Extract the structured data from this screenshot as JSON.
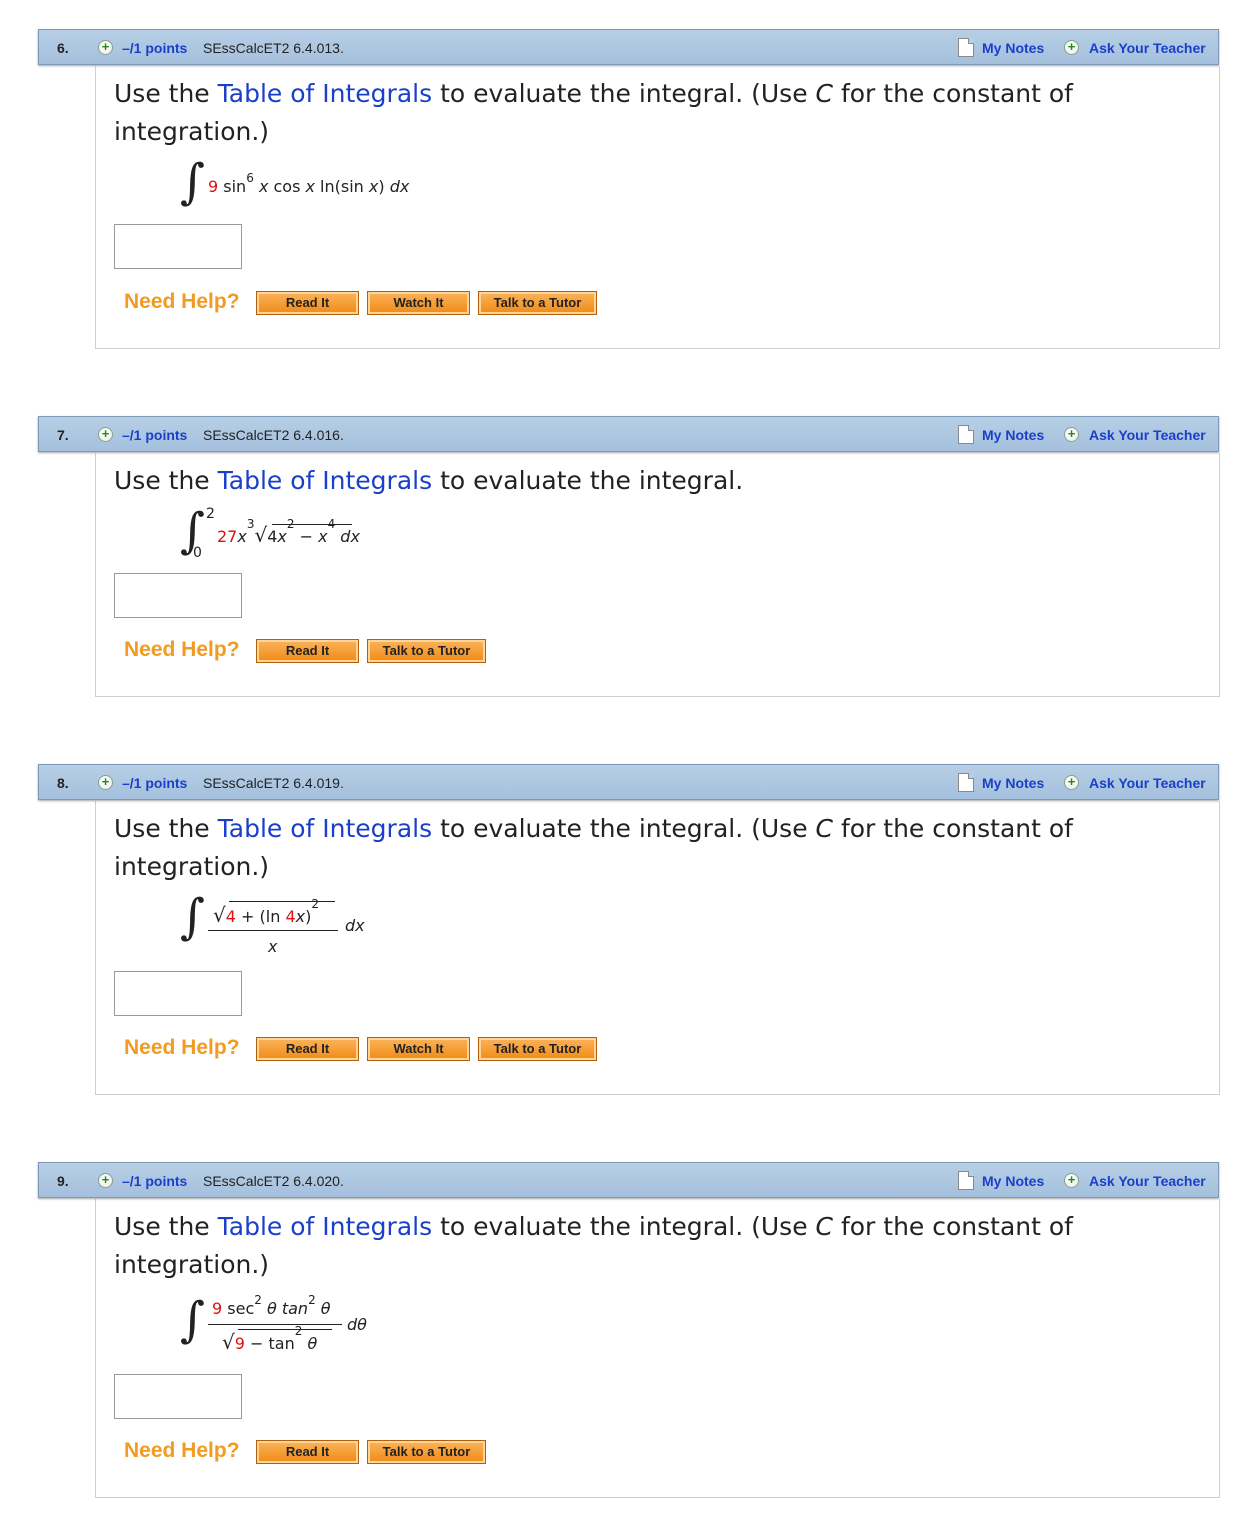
{
  "common": {
    "points": "–/1 points",
    "my_notes": "My Notes",
    "ask_teacher": "Ask Your Teacher",
    "need_help": "Need Help?",
    "read_it": "Read It",
    "watch_it": "Watch It",
    "talk_tutor": "Talk to a Tutor",
    "prompt_start": "Use the ",
    "prompt_link": "Table of Integrals",
    "prompt_mid": " to evaluate the integral.",
    "prompt_const_a": " (Use ",
    "prompt_const_c": "C",
    "prompt_const_b": " for the constant of",
    "prompt_const_line2": "integration.)"
  },
  "questions": [
    {
      "number": "6.",
      "id": "SEssCalcET2 6.4.013.",
      "expr": {
        "coef": "9",
        "a": " sin",
        "exp": "6",
        "b": " ",
        "x1": "x",
        "c": " cos ",
        "x2": "x",
        "d": " ln(sin ",
        "x3": "x",
        "e": ") ",
        "dx": "dx"
      }
    },
    {
      "number": "7.",
      "id": "SEssCalcET2 6.4.016.",
      "expr": {
        "upper": "2",
        "lower": "0",
        "coef": "27",
        "x": "x",
        "exp3": "3",
        "rad_a": "4",
        "rad_x": "x",
        "rad_exp2": "2",
        "rad_minus": " − ",
        "rad_x2": "x",
        "rad_exp4": "4",
        "dx": "dx"
      }
    },
    {
      "number": "8.",
      "id": "SEssCalcET2 6.4.019.",
      "expr": {
        "n1": "4",
        "n2": " + (ln ",
        "n3": "4",
        "n4": "x",
        "n5": ")",
        "exp": "2",
        "den": "x",
        "dx": "dx"
      }
    },
    {
      "number": "9.",
      "id": "SEssCalcET2 6.4.020.",
      "expr": {
        "coef": "9",
        "num": " sec",
        "e1": "2",
        "th1": " θ tan",
        "e2": "2",
        "th2": " θ",
        "d1": "9",
        "d2": " − tan",
        "de": "2",
        "d3": " θ",
        "dth": "dθ"
      }
    }
  ]
}
